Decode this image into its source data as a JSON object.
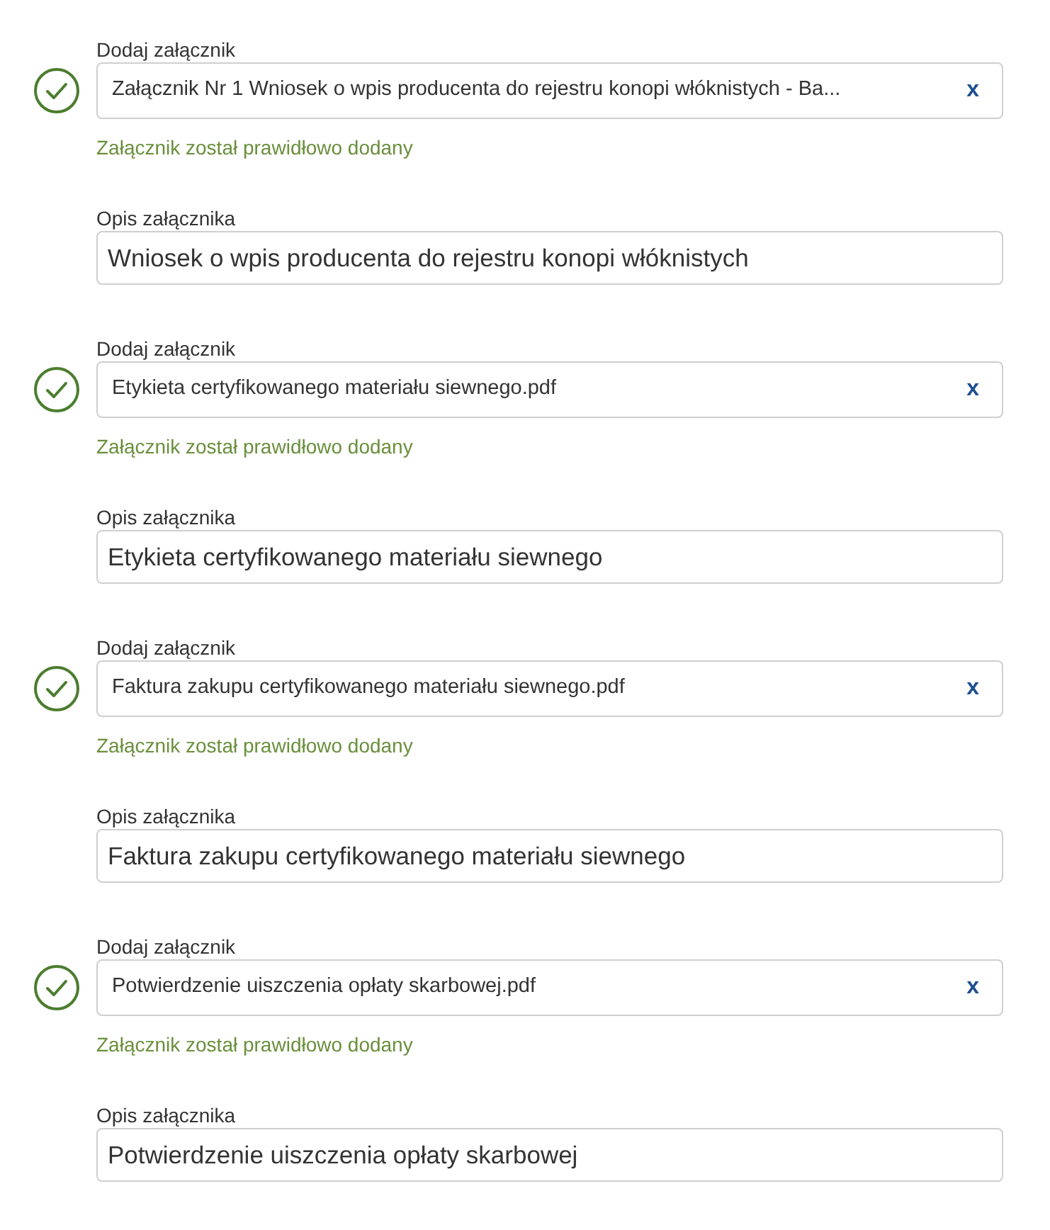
{
  "attachments": [
    {
      "uploaded": true,
      "label": "Dodaj załącznik",
      "file_name": "Załącznik Nr 1 Wniosek o wpis producenta do rejestru konopi włóknistych - Ba...",
      "remove": "x",
      "status": "Załącznik został prawidłowo dodany",
      "description_label": "Opis załącznika",
      "description": "Wniosek o wpis producenta do rejestru konopi włóknistych"
    },
    {
      "uploaded": true,
      "label": "Dodaj załącznik",
      "file_name": "Etykieta certyfikowanego materiału siewnego.pdf",
      "remove": "x",
      "status": "Załącznik został prawidłowo dodany",
      "description_label": "Opis załącznika",
      "description": "Etykieta certyfikowanego materiału siewnego"
    },
    {
      "uploaded": true,
      "label": "Dodaj załącznik",
      "file_name": "Faktura zakupu certyfikowanego materiału siewnego.pdf",
      "remove": "x",
      "status": "Załącznik został prawidłowo dodany",
      "description_label": "Opis załącznika",
      "description": "Faktura zakupu certyfikowanego materiału siewnego"
    },
    {
      "uploaded": true,
      "label": "Dodaj załącznik",
      "file_name": "Potwierdzenie uiszczenia opłaty skarbowej.pdf",
      "remove": "x",
      "status": "Załącznik został prawidłowo dodany",
      "description_label": "Opis załącznika",
      "description": "Potwierdzenie uiszczenia opłaty skarbowej"
    }
  ]
}
